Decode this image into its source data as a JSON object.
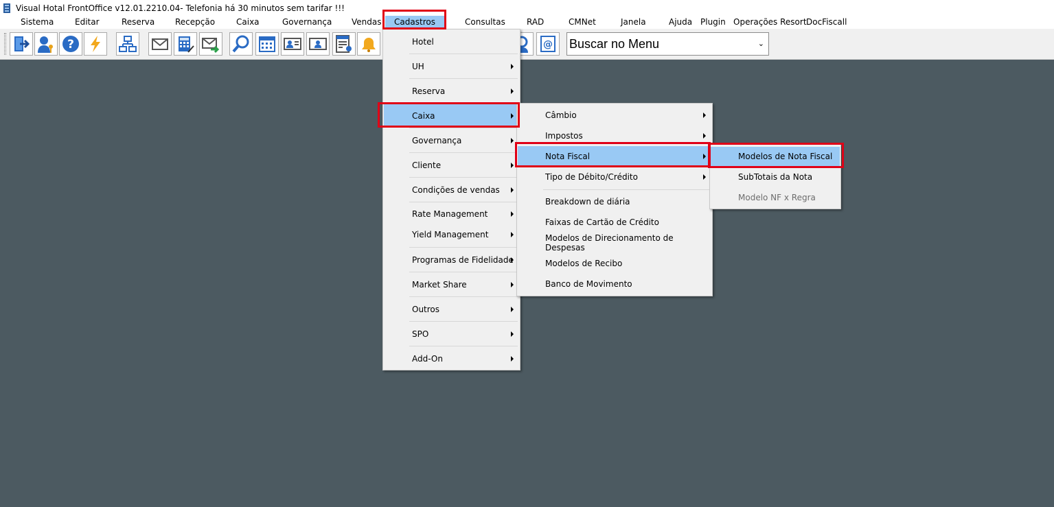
{
  "window": {
    "title": "Visual Hotal FrontOffice v12.01.2210.04- Telefonia há 30 minutos sem tarifar !!!"
  },
  "menubar": {
    "items": [
      "Sistema",
      "Editar",
      "Reserva",
      "Recepção",
      "Caixa",
      "Governança",
      "Vendas",
      "Cadastros",
      "Consultas",
      "RAD",
      "CMNet",
      "Janela",
      "Ajuda",
      "Plugin",
      "Operações Resort",
      "DocFiscall"
    ],
    "active": "Cadastros"
  },
  "toolbar": {
    "buttons": [
      "logout-icon",
      "user-key-icon",
      "help-icon",
      "lightning-icon",
      "org-chart-icon",
      "mail-icon",
      "calculator-icon",
      "mail-forward-icon",
      "search-icon",
      "calendar-icon",
      "guest-card-icon",
      "id-card-icon",
      "room-chart-icon",
      "bell-icon",
      "user-support-icon",
      "email-at-icon"
    ],
    "search": {
      "value": "Buscar no Menu"
    }
  },
  "menus": {
    "cadastros": {
      "items": [
        "Hotel",
        "UH",
        "Reserva",
        "Caixa",
        "Governança",
        "Cliente",
        "Condições de vendas",
        "Rate Management",
        "Yield Management",
        "Programas de Fidelidade",
        "Market Share",
        "Outros",
        "SPO",
        "Add-On"
      ],
      "selected": "Caixa"
    },
    "caixa": {
      "items": [
        "Câmbio",
        "Impostos",
        "Nota Fiscal",
        "Tipo de Débito/Crédito",
        "Breakdown de diária",
        "Faixas de Cartão de Crédito",
        "Modelos de Direcionamento de Despesas",
        "Modelos de Recibo",
        "Banco de Movimento"
      ],
      "selected": "Nota Fiscal"
    },
    "nota_fiscal": {
      "items": [
        "Modelos de Nota Fiscal",
        "SubTotais da Nota",
        "Modelo NF x Regra"
      ],
      "selected": "Modelos de Nota Fiscal",
      "disabled": [
        "Modelo NF x Regra"
      ]
    }
  },
  "colors": {
    "desktop": "#4c5a61",
    "selection": "#99c9f4",
    "highlight_box": "#e00016"
  }
}
